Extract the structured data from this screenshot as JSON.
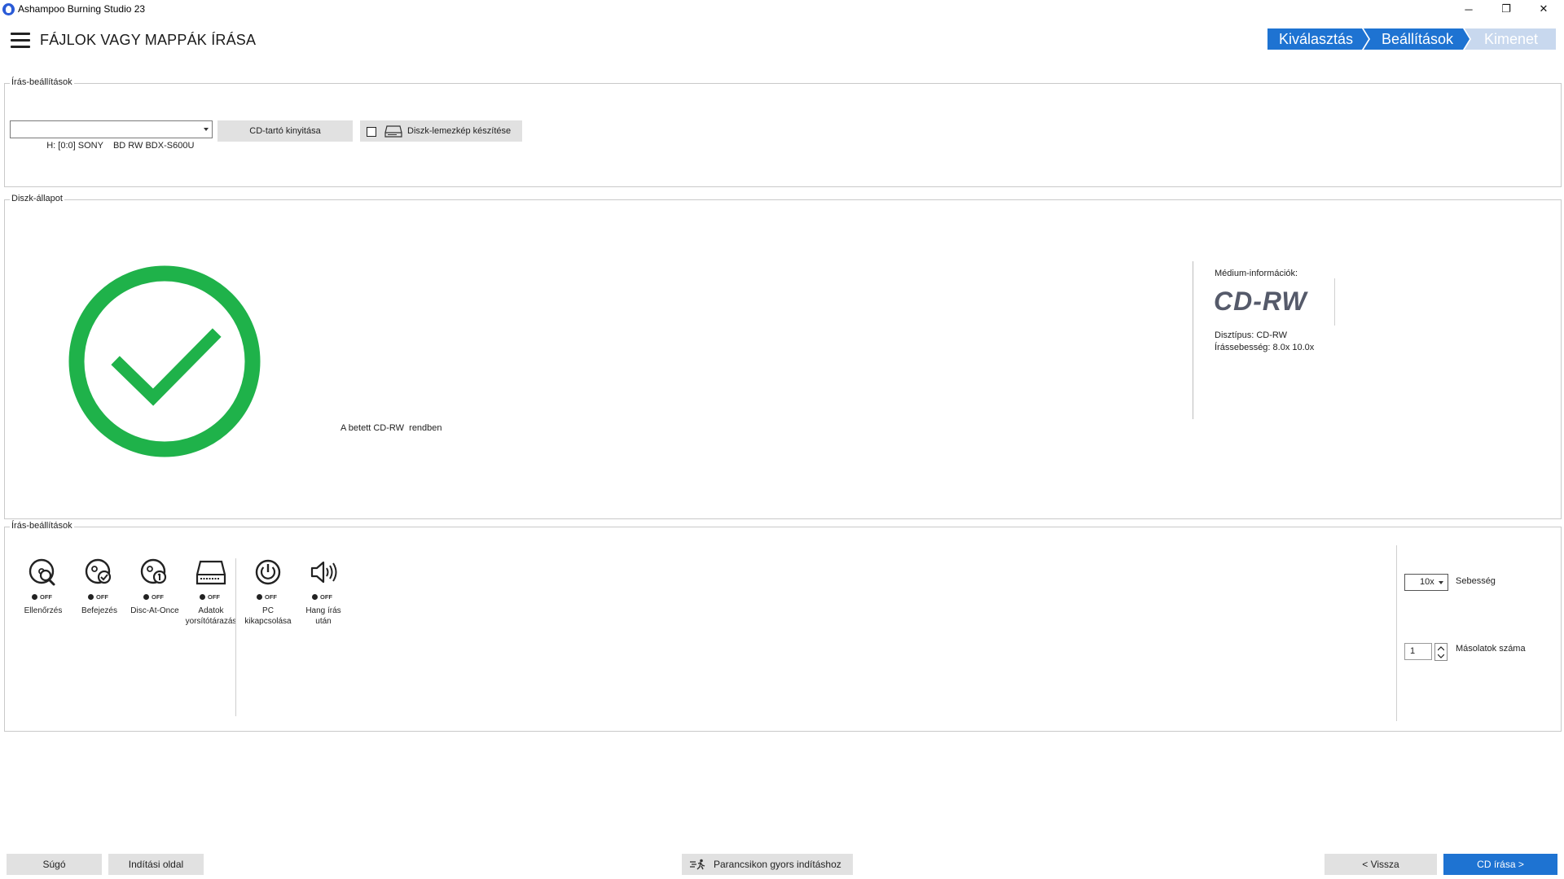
{
  "window": {
    "title": "Ashampoo Burning Studio 23",
    "minimize": "─",
    "maximize": "❐",
    "close": "✕"
  },
  "header": {
    "title": "FÁJLOK VAGY MAPPÁK ÍRÁSA",
    "steps": [
      {
        "label": "Kiválasztás",
        "state": "done"
      },
      {
        "label": "Beállítások",
        "state": "active"
      },
      {
        "label": "Kimenet",
        "state": "pending"
      }
    ]
  },
  "write_settings_top": {
    "label": "Írás-beállítások",
    "drive": "H: [0:0] SONY    BD RW BDX-S600U",
    "eject_label": "CD-tartó kinyitása",
    "image_label": "Diszk-lemezkép készítése",
    "image_checked": false
  },
  "disc_status": {
    "label": "Diszk-állapot",
    "status_text": "A betett CD-RW  rendben",
    "status_color": "#1fb24a",
    "media_info_label": "Médium-információk:",
    "media_type_big": "CD-RW",
    "disc_type": "Disztípus: CD-RW",
    "write_speed": "Írássebesség: 8.0x 10.0x"
  },
  "write_settings_bottom": {
    "label": "Írás-beállítások",
    "options": [
      {
        "icon": "disc-verify-icon",
        "state": "OFF",
        "label": "Ellenőrzés"
      },
      {
        "icon": "disc-finalize-icon",
        "state": "OFF",
        "label": "Befejezés"
      },
      {
        "icon": "disc-at-once-icon",
        "state": "OFF",
        "label": "Disc-At-Once"
      },
      {
        "icon": "drive-cache-icon",
        "state": "OFF",
        "label": "Adatok\nyorsítótárazás"
      },
      {
        "icon": "power-icon",
        "state": "OFF",
        "label": "PC\nkikapcsolása"
      },
      {
        "icon": "speaker-icon",
        "state": "OFF",
        "label": "Hang írás\nután"
      }
    ],
    "speed": "10x",
    "speed_label": "Sebesség",
    "copies": "1",
    "copies_label": "Másolatok száma"
  },
  "footer": {
    "help": "Súgó",
    "start_page": "Indítási oldal",
    "shortcut": "Parancsikon gyors indításhoz",
    "back": "< Vissza",
    "write": "CD  írása  >"
  },
  "colors": {
    "accent": "#1e73d2",
    "step_pending": "#c8d8ee",
    "ok_green": "#1fb24a"
  }
}
